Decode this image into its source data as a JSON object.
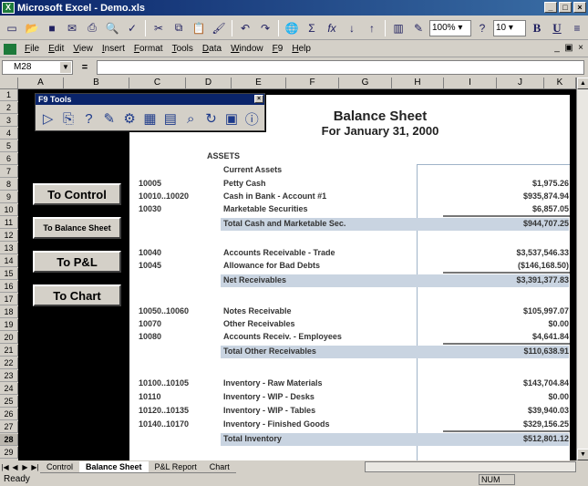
{
  "window": {
    "title": "Microsoft Excel - Demo.xls"
  },
  "toolbar": {
    "zoom": "100%",
    "font_size": "10"
  },
  "menu": [
    "File",
    "Edit",
    "View",
    "Insert",
    "Format",
    "Tools",
    "Data",
    "Window",
    "F9",
    "Help"
  ],
  "formula": {
    "cell_ref": "M28",
    "eq": "="
  },
  "columns": [
    "A",
    "B",
    "C",
    "D",
    "E",
    "F",
    "G",
    "H",
    "I",
    "J",
    "K"
  ],
  "rows": [
    "1",
    "2",
    "3",
    "4",
    "5",
    "6",
    "7",
    "8",
    "9",
    "10",
    "11",
    "12",
    "13",
    "14",
    "15",
    "16",
    "17",
    "18",
    "19",
    "20",
    "21",
    "22",
    "23",
    "24",
    "25",
    "26",
    "27",
    "28",
    "29"
  ],
  "f9_tools": {
    "title": "F9 Tools"
  },
  "nav_buttons": [
    "To Control",
    "To Balance Sheet",
    "To P&L",
    "To Chart"
  ],
  "report": {
    "title": "Balance Sheet",
    "subtitle": "For January 31, 2000",
    "section": "ASSETS",
    "subsection": "Current Assets",
    "lines": [
      {
        "acct": "10005",
        "desc": "Petty Cash",
        "amount": "$1,975.26"
      },
      {
        "acct": "10010..10020",
        "desc": "Cash in Bank - Account #1",
        "amount": "$935,874.94"
      },
      {
        "acct": "10030",
        "desc": "Marketable Securities",
        "amount": "$6,857.05"
      },
      {
        "acct": "",
        "desc": "Total Cash and Marketable Sec.",
        "amount": "$944,707.25"
      },
      {
        "acct": "10040",
        "desc": "Accounts Receivable - Trade",
        "amount": "$3,537,546.33"
      },
      {
        "acct": "10045",
        "desc": "Allowance for Bad Debts",
        "amount": "($146,168.50)"
      },
      {
        "acct": "",
        "desc": "Net Receivables",
        "amount": "$3,391,377.83"
      },
      {
        "acct": "10050..10060",
        "desc": "Notes Receivable",
        "amount": "$105,997.07"
      },
      {
        "acct": "10070",
        "desc": "Other Receivables",
        "amount": "$0.00"
      },
      {
        "acct": "10080",
        "desc": "Accounts Receiv. - Employees",
        "amount": "$4,641.84"
      },
      {
        "acct": "",
        "desc": "Total Other Receivables",
        "amount": "$110,638.91"
      },
      {
        "acct": "10100..10105",
        "desc": "Inventory - Raw Materials",
        "amount": "$143,704.84"
      },
      {
        "acct": "10110",
        "desc": "Inventory - WIP - Desks",
        "amount": "$0.00"
      },
      {
        "acct": "10120..10135",
        "desc": "Inventory - WIP - Tables",
        "amount": "$39,940.03"
      },
      {
        "acct": "10140..10170",
        "desc": "Inventory - Finished Goods",
        "amount": "$329,156.25"
      },
      {
        "acct": "",
        "desc": "Total Inventory",
        "amount": "$512,801.12"
      }
    ]
  },
  "tabs": [
    "Control",
    "Balance Sheet",
    "P&L Report",
    "Chart"
  ],
  "status": {
    "left": "Ready",
    "num": "NUM"
  }
}
